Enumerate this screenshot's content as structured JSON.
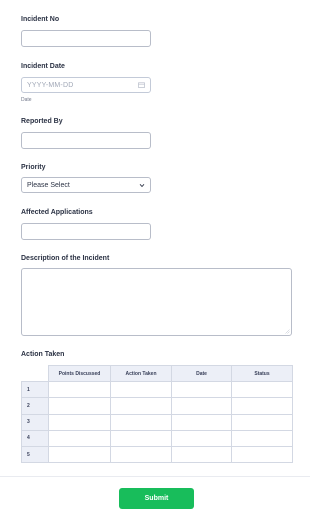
{
  "form": {
    "incident_no": {
      "label": "Incident No",
      "value": ""
    },
    "incident_date": {
      "label": "Incident Date",
      "placeholder": "YYYY-MM-DD",
      "sublabel": "Date",
      "icon": "calendar-icon"
    },
    "reported_by": {
      "label": "Reported By",
      "value": ""
    },
    "priority": {
      "label": "Priority",
      "selected": "Please Select",
      "icon": "chevron-down-icon"
    },
    "affected_applications": {
      "label": "Affected Applications",
      "value": ""
    },
    "description": {
      "label": "Description of the Incident",
      "value": ""
    },
    "action_taken": {
      "label": "Action Taken",
      "columns": [
        "Points Discussed",
        "Action Taken",
        "Date",
        "Status"
      ],
      "rows": [
        "1",
        "2",
        "3",
        "4",
        "5"
      ]
    },
    "submit_label": "Submit"
  },
  "colors": {
    "submit_bg": "#18bd5b",
    "table_header_bg": "#eceff7",
    "input_border": "#b8bdc9"
  }
}
